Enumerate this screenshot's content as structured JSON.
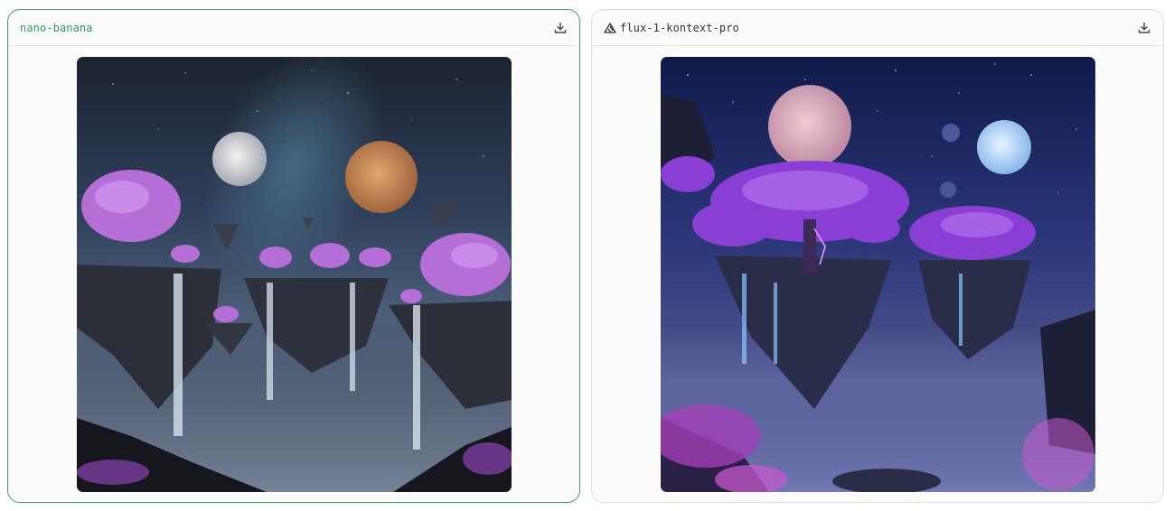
{
  "cards": [
    {
      "model": "nano-banana",
      "selected": true,
      "download_icon": "download-icon",
      "image_alt": "floating islands with waterfalls under two moons"
    },
    {
      "model": "flux-1-kontext-pro",
      "provider_icon": "triangle-logo-icon",
      "selected": false,
      "download_icon": "download-icon",
      "image_alt": "purple trees on floating islands under moons"
    }
  ],
  "colors": {
    "selected_border": "#3aa466",
    "selected_text": "#2f9a5a",
    "border": "#dcdcdc"
  }
}
